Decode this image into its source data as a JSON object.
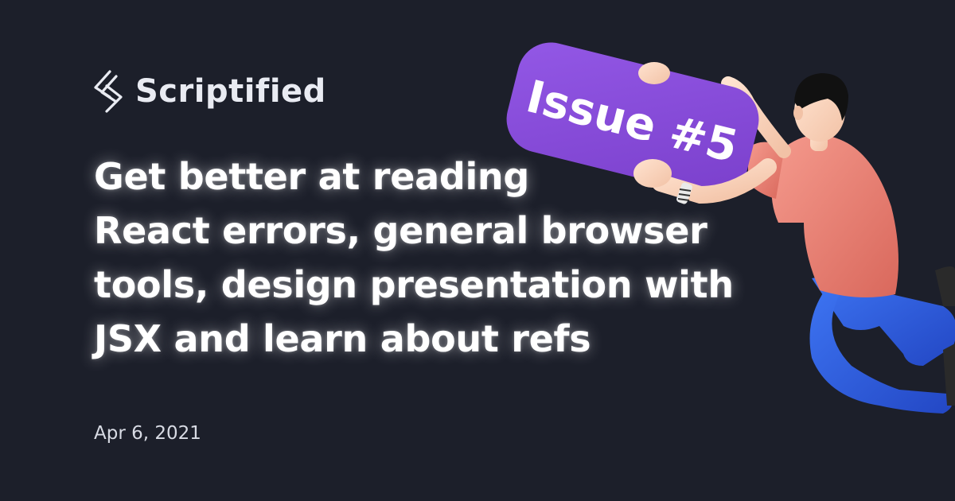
{
  "brand": {
    "name": "Scriptified",
    "logo_icon": "scriptified-logo-icon"
  },
  "headline": {
    "lines": [
      "Get better at reading",
      "React errors, general browser",
      "tools, design presentation with",
      "JSX and learn about refs"
    ]
  },
  "date": "Apr 6, 2021",
  "issue_sign": {
    "label": "Issue #5"
  },
  "colors": {
    "background": "#1c1f2a",
    "accent_purple": "#8a4fd9",
    "text_white": "#ffffff",
    "shirt": "#ee8377",
    "pants": "#2f5fe0"
  }
}
